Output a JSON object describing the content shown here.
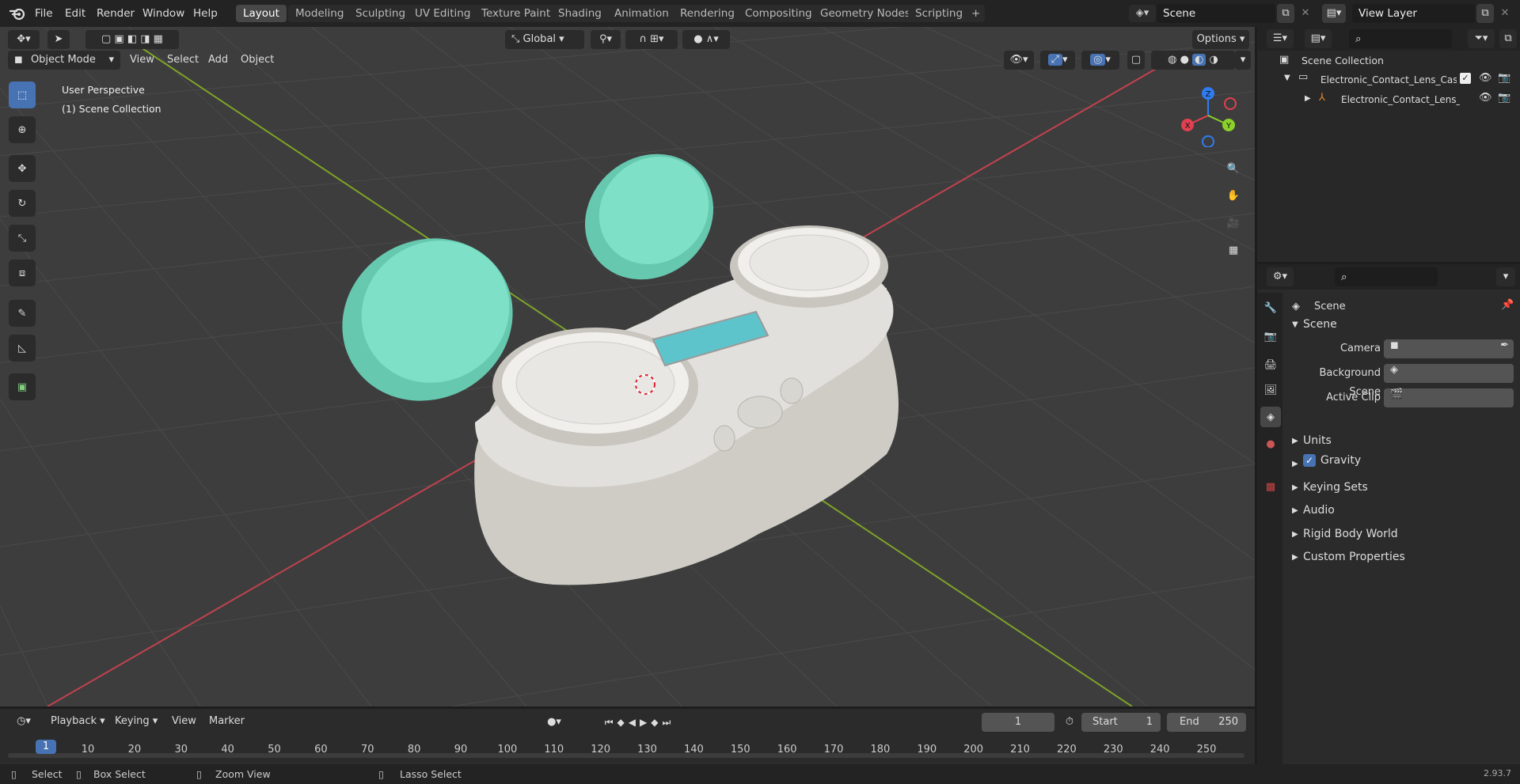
{
  "menu": {
    "file": "File",
    "edit": "Edit",
    "render": "Render",
    "window": "Window",
    "help": "Help"
  },
  "workspaces": [
    "Layout",
    "Modeling",
    "Sculpting",
    "UV Editing",
    "Texture Paint",
    "Shading",
    "Animation",
    "Rendering",
    "Compositing",
    "Geometry Nodes",
    "Scripting"
  ],
  "active_workspace": "Layout",
  "scene_name": "Scene",
  "view_layer": "View Layer",
  "viewport": {
    "orientation": "Global",
    "options_label": "Options",
    "mode": "Object Mode",
    "menu": {
      "view": "View",
      "select": "Select",
      "add": "Add",
      "object": "Object"
    },
    "overlay_text": {
      "perspective": "User Perspective",
      "collection": "(1) Scene Collection"
    },
    "gizmo_axes": {
      "x": "X",
      "y": "Y",
      "z": "Z"
    },
    "tools": [
      "select-box-tool",
      "cursor-tool",
      "move-tool",
      "rotate-tool",
      "scale-tool",
      "transform-tool",
      "annotate-tool",
      "measure-tool",
      "add-cube-tool"
    ],
    "nav": [
      "zoom-icon",
      "hand-icon",
      "camera-icon",
      "grid-icon"
    ],
    "colors": {
      "grid_bg": "#3d3d3d",
      "x_axis": "#c0424f",
      "y_axis": "#7ea327",
      "lid": "#7fe0c8",
      "case": "#d4d2cd",
      "screen": "#5ec4cc"
    }
  },
  "outliner": {
    "root": "Scene Collection",
    "items": [
      {
        "label": "Electronic_Contact_Lens_Case"
      },
      {
        "label": "Electronic_Contact_Lens_"
      }
    ]
  },
  "properties": {
    "header": "Scene",
    "panel": "Scene",
    "fields": {
      "camera": "Camera",
      "background_scene": "Background Scene",
      "active_clip": "Active Clip"
    },
    "sections": [
      "Units",
      "Gravity",
      "Keying Sets",
      "Audio",
      "Rigid Body World",
      "Custom Properties"
    ],
    "gravity_checked": true
  },
  "timeline": {
    "menu": {
      "playback": "Playback",
      "keying": "Keying",
      "view": "View",
      "marker": "Marker"
    },
    "current_frame": "1",
    "start_label": "Start",
    "start": "1",
    "end_label": "End",
    "end": "250",
    "ticks": [
      "1",
      "10",
      "20",
      "30",
      "40",
      "50",
      "60",
      "70",
      "80",
      "90",
      "100",
      "110",
      "120",
      "130",
      "140",
      "150",
      "160",
      "170",
      "180",
      "190",
      "200",
      "210",
      "220",
      "230",
      "240",
      "250"
    ]
  },
  "status": {
    "select": "Select",
    "box_select": "Box Select",
    "zoom_view": "Zoom View",
    "lasso_select": "Lasso Select",
    "version": "2.93.7"
  }
}
